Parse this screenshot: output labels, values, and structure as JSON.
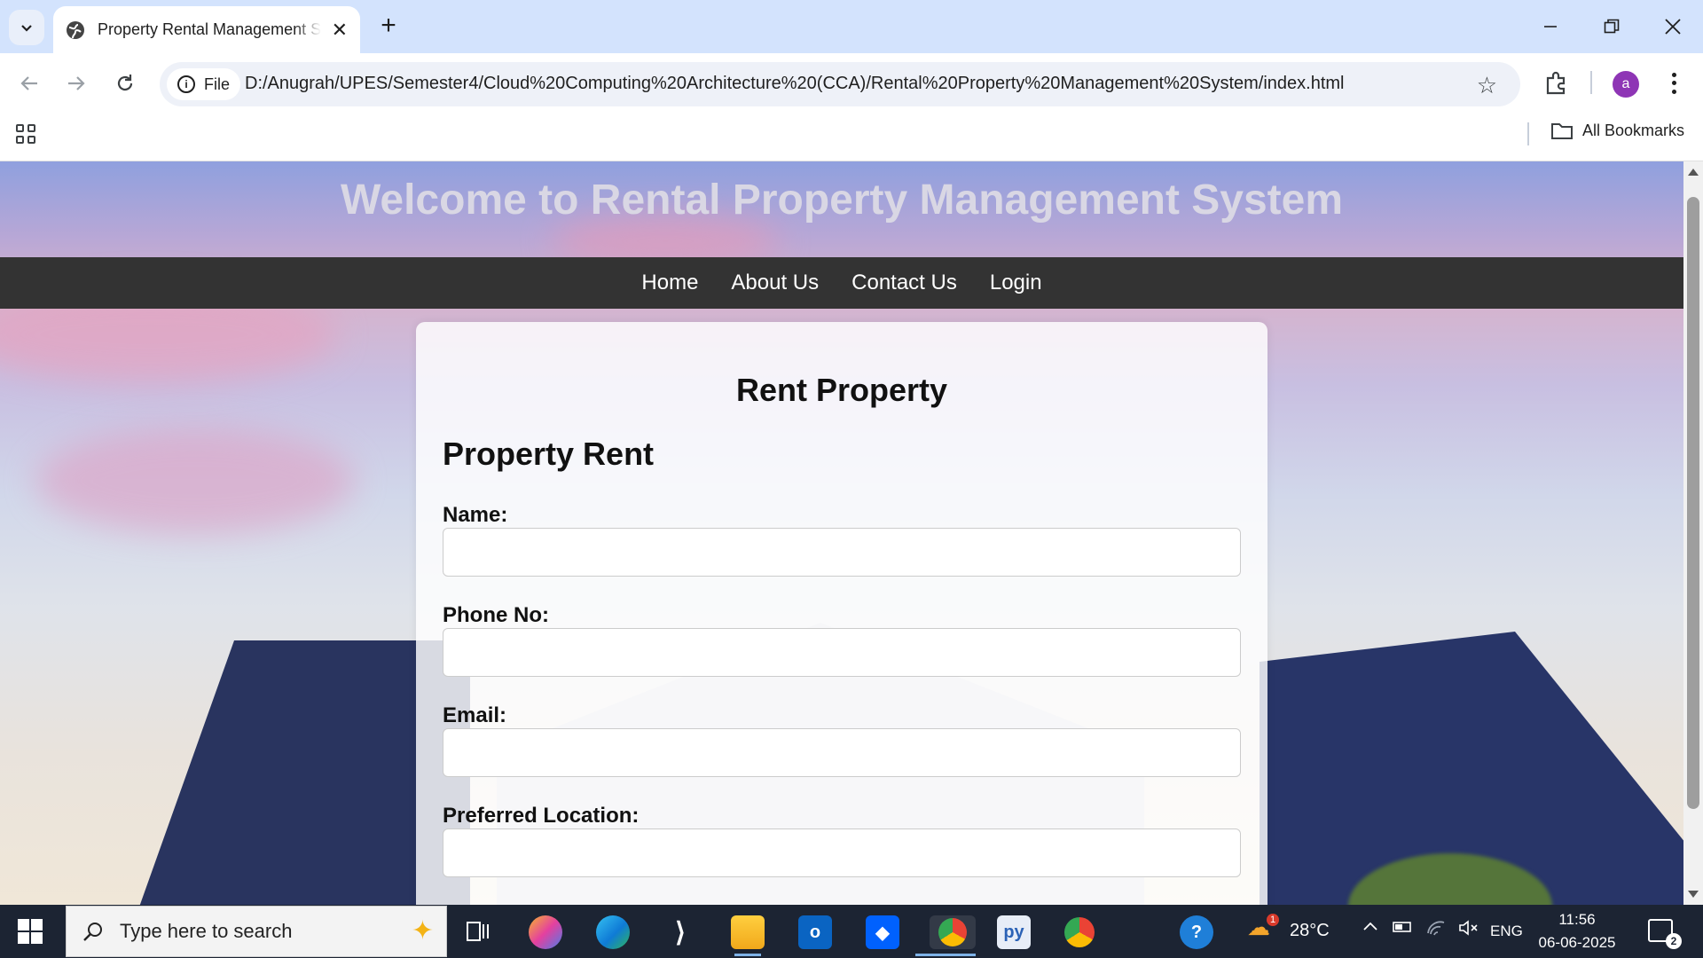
{
  "browser": {
    "tab_title": "Property Rental Management System",
    "new_tab": "+",
    "chip_label": "File",
    "url": "D:/Anugrah/UPES/Semester4/Cloud%20Computing%20Architecture%20(CCA)/Rental%20Property%20Management%20System/index.html",
    "avatar_letter": "a",
    "all_bookmarks": "All Bookmarks"
  },
  "site": {
    "title": "Welcome to Rental Property Management System",
    "nav": [
      "Home",
      "About Us",
      "Contact Us",
      "Login"
    ]
  },
  "form": {
    "card_title": "Rent Property",
    "section_title": "Property Rent",
    "fields": [
      {
        "label": "Name:",
        "value": ""
      },
      {
        "label": "Phone No:",
        "value": ""
      },
      {
        "label": "Email:",
        "value": ""
      },
      {
        "label": "Preferred Location:",
        "value": ""
      }
    ]
  },
  "taskbar": {
    "search_placeholder": "Type here to search",
    "temperature": "28°C",
    "language": "ENG",
    "time": "11:56",
    "date": "06-06-2025",
    "weather_badge": "1",
    "notifications": "2"
  }
}
